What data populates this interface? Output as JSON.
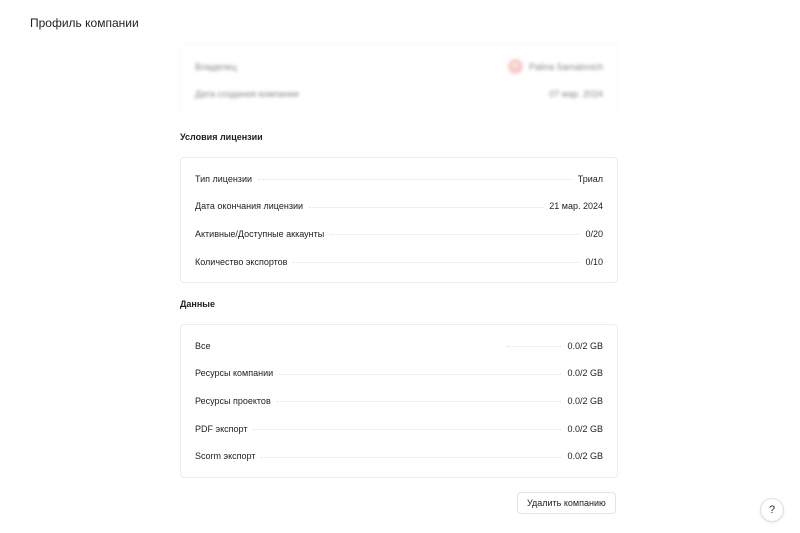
{
  "header": {
    "title": "Профиль компании"
  },
  "owner_card": {
    "rows": [
      {
        "label": "Владелец",
        "avatar_initial": "P",
        "value": "Palina Samalovich"
      },
      {
        "label": "Дата создания компании",
        "value": "07 мар. 2024"
      }
    ],
    "avatar_color": "#f3a39a"
  },
  "license": {
    "title": "Условия лицензии",
    "rows": [
      {
        "label": "Тип лицензии",
        "value": "Триал"
      },
      {
        "label": "Дата окончания лицензии",
        "value": "21 мар. 2024"
      },
      {
        "label": "Активные/Доступные аккаунты",
        "value": "0/20"
      },
      {
        "label": "Количество экспортов",
        "value": "0/10"
      }
    ]
  },
  "data_section": {
    "title": "Данные",
    "rows": [
      {
        "label": "Все",
        "value": "0.0/2 GB"
      },
      {
        "label": "Ресурсы компании",
        "value": "0.0/2 GB"
      },
      {
        "label": "Ресурсы проектов",
        "value": "0.0/2 GB"
      },
      {
        "label": "PDF экспорт",
        "value": "0.0/2 GB"
      },
      {
        "label": "Scorm экспорт",
        "value": "0.0/2 GB"
      }
    ]
  },
  "actions": {
    "delete_label": "Удалить компанию",
    "help_label": "?"
  }
}
